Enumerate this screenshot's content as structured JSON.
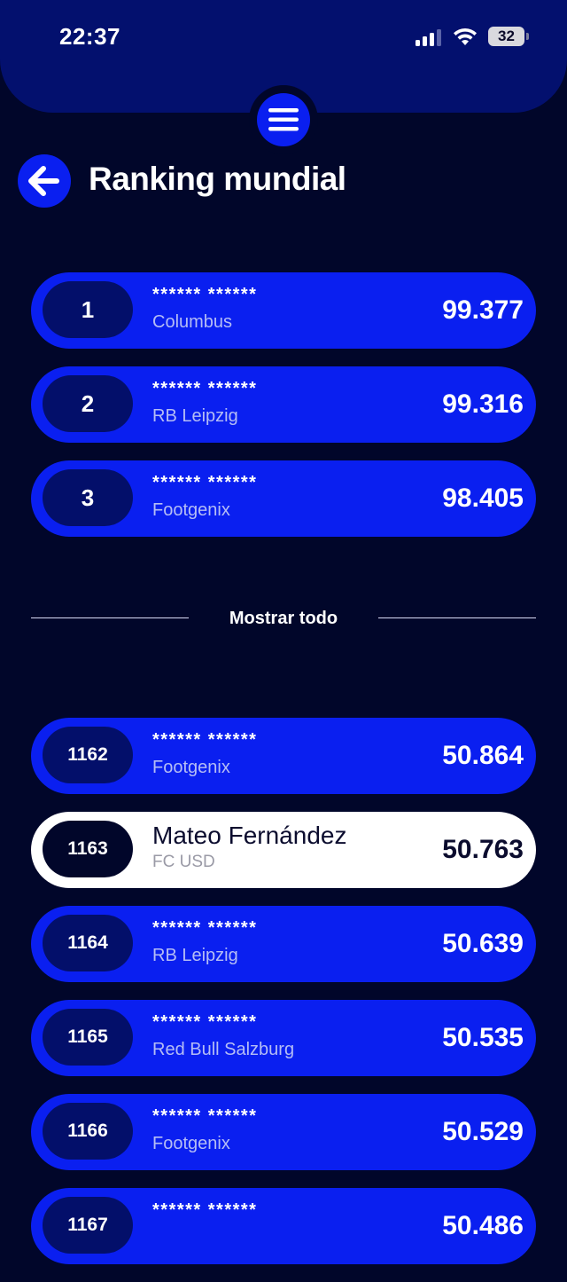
{
  "status_bar": {
    "time": "22:37",
    "battery": "32",
    "icons": [
      "signal-icon",
      "wifi-icon",
      "battery-icon"
    ]
  },
  "header": {
    "title": "Ranking mundial",
    "back_icon": "arrow-left-icon",
    "menu_icon": "hamburger-menu-icon"
  },
  "colors": {
    "background": "#01062a",
    "accent": "#0a1ff0",
    "highlight_row": "#ffffff"
  },
  "top_rankings": [
    {
      "rank": "1",
      "player": "****** ******",
      "club": "Columbus",
      "score": "99.377"
    },
    {
      "rank": "2",
      "player": "****** ******",
      "club": "RB Leipzig",
      "score": "99.316"
    },
    {
      "rank": "3",
      "player": "****** ******",
      "club": "Footgenix",
      "score": "98.405"
    }
  ],
  "show_all_label": "Mostrar todo",
  "nearby_rankings": [
    {
      "rank": "1162",
      "player": "****** ******",
      "club": "Footgenix",
      "score": "50.864"
    },
    {
      "rank": "1163",
      "player": "Mateo Fernández",
      "club": "FC USD",
      "score": "50.763",
      "is_current_user": true
    },
    {
      "rank": "1164",
      "player": "****** ******",
      "club": "RB Leipzig",
      "score": "50.639"
    },
    {
      "rank": "1165",
      "player": "****** ******",
      "club": "Red Bull Salzburg",
      "score": "50.535"
    },
    {
      "rank": "1166",
      "player": "****** ******",
      "club": "Footgenix",
      "score": "50.529"
    },
    {
      "rank": "1167",
      "player": "****** ******",
      "club": "",
      "score": "50.486"
    }
  ]
}
